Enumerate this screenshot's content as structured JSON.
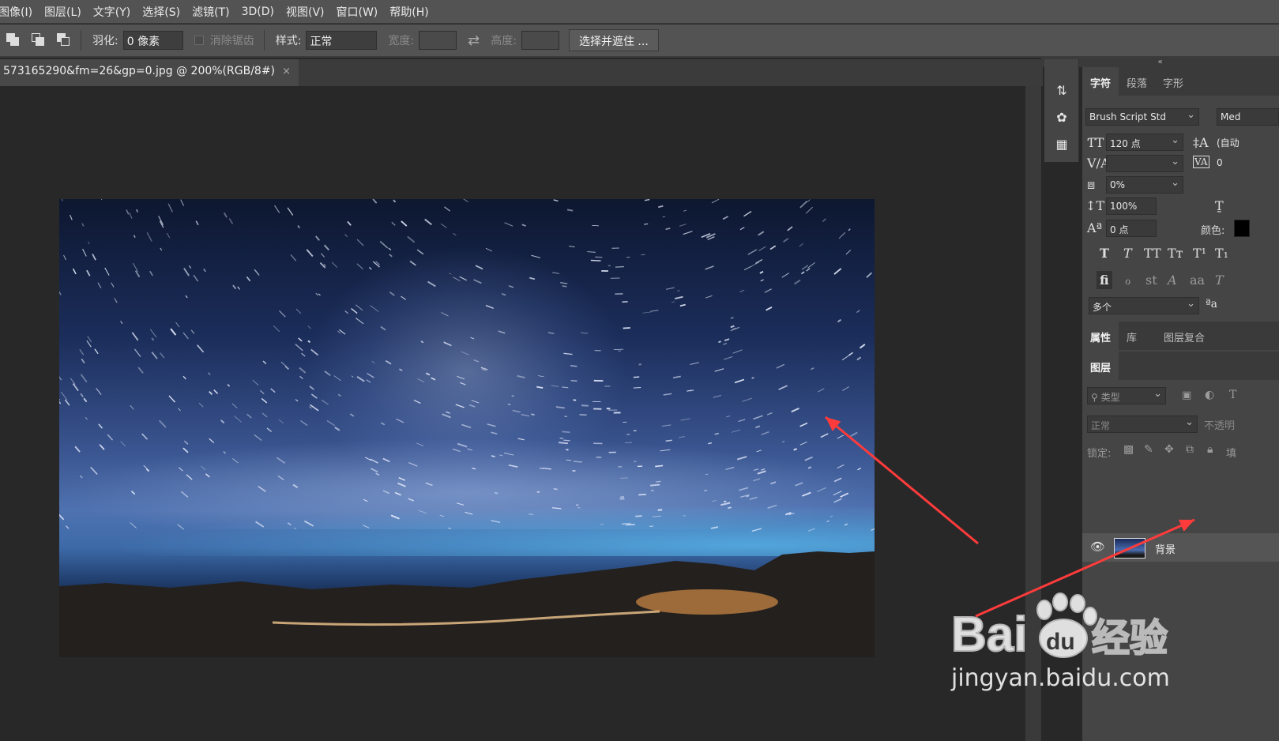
{
  "menu": [
    "图像(I)",
    "图层(L)",
    "文字(Y)",
    "选择(S)",
    "滤镜(T)",
    "3D(D)",
    "视图(V)",
    "窗口(W)",
    "帮助(H)"
  ],
  "options": {
    "feather_label": "羽化:",
    "feather_value": "0 像素",
    "antialias_label": "消除锯齿",
    "style_label": "样式:",
    "style_value": "正常",
    "width_label": "宽度:",
    "height_label": "高度:",
    "select_mask_button": "选择并遮住 ..."
  },
  "document_tab": {
    "title": "573165290&fm=26&gp=0.jpg @ 200%(RGB/8#)",
    "close": "×"
  },
  "panel_collapse": "«",
  "character_panel": {
    "tabs": [
      "字符",
      "段落",
      "字形"
    ],
    "font_family": "Brush Script Std",
    "font_style": "Med",
    "font_size": "120 点",
    "leading": "(自动",
    "kerning": "",
    "tracking": "0",
    "tsume": "0%",
    "vertical_scale": "100%",
    "baseline_shift": "0 点",
    "color_label": "颜色:",
    "language": "多个"
  },
  "properties_tabs": [
    "属性",
    "库",
    "图层复合"
  ],
  "layers_panel": {
    "tab": "图层",
    "filter_label": "类型",
    "blend_mode": "正常",
    "opacity_label": "不透明",
    "lock_label": "锁定:",
    "fill_label": "填",
    "layer_name": "背景"
  },
  "watermark": {
    "brand": "Bai",
    "brand_suffix": "经验",
    "url": "jingyan.baidu.com"
  },
  "colors": {
    "arrow": "#ff3b3b",
    "panel_bg": "#454545",
    "canvas_bg": "#282828"
  }
}
